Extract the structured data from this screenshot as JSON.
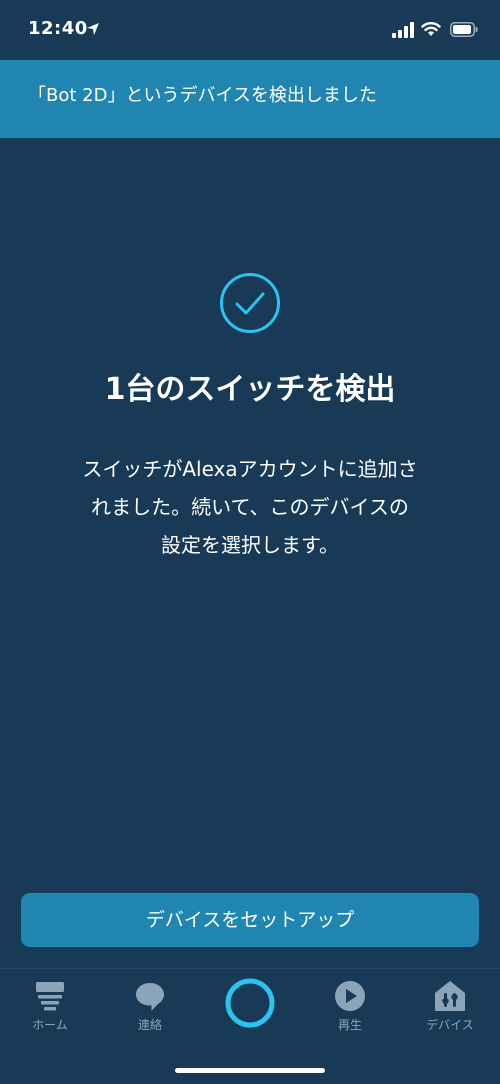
{
  "status_bar": {
    "time": "12:40"
  },
  "banner": {
    "text": "「Bot 2D」というデバイスを検出しました"
  },
  "main": {
    "title": "1台のスイッチを検出",
    "description_lines": [
      "スイッチがAlexaアカウントに追加さ",
      "れました。続いて、このデバイスの",
      "設定を選択します。"
    ]
  },
  "setup_button": {
    "label": "デバイスをセットアップ"
  },
  "nav": {
    "items": [
      {
        "label": "ホーム",
        "icon": "home-icon"
      },
      {
        "label": "連絡",
        "icon": "chat-bubble-icon"
      },
      {
        "label": "",
        "icon": "alexa-ring-icon"
      },
      {
        "label": "再生",
        "icon": "play-icon"
      },
      {
        "label": "デバイス",
        "icon": "devices-icon"
      }
    ]
  },
  "colors": {
    "background": "#183a56",
    "accent": "#2086b1",
    "check": "#29c4f0",
    "alexa_ring": "#29c4f0",
    "nav_inactive": "#8ca4b8"
  }
}
